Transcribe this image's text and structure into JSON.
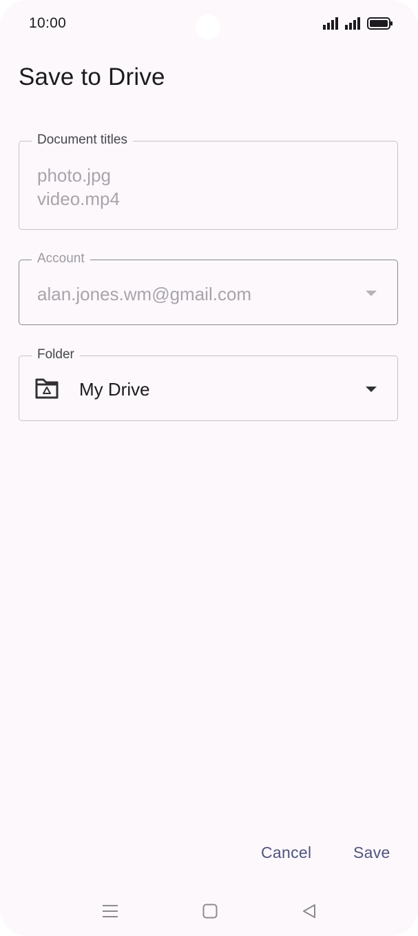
{
  "status_bar": {
    "time": "10:00",
    "icons": [
      "signal-icon",
      "signal-icon",
      "battery-icon"
    ]
  },
  "header": {
    "title": "Save to Drive"
  },
  "document_field": {
    "label": "Document titles",
    "lines": [
      "photo.jpg",
      "video.mp4"
    ]
  },
  "account_field": {
    "label": "Account",
    "value": "alan.jones.wm@gmail.com",
    "icon": "chevron-down-icon"
  },
  "folder_field": {
    "label": "Folder",
    "value": "My Drive",
    "icon": "drive-folder-icon"
  },
  "actions": {
    "cancel_label": "Cancel",
    "save_label": "Save"
  },
  "nav_bar": {
    "icons": [
      "menu-icon",
      "home-icon",
      "back-icon"
    ]
  },
  "colors": {
    "background": "#fcf8fc",
    "accent": "#50547f",
    "text_primary": "#1c1b1f",
    "text_disabled": "#a7a5ab"
  }
}
